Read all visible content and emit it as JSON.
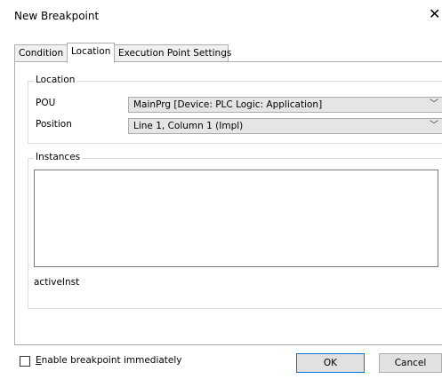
{
  "window": {
    "title": "New Breakpoint",
    "close_glyph": "✕"
  },
  "tabs": [
    {
      "label": "Condition"
    },
    {
      "label": "Location"
    },
    {
      "label": "Execution Point Settings"
    }
  ],
  "location_group": {
    "legend": "Location",
    "pou_label": "POU",
    "pou_value": "MainPrg [Device: PLC Logic: Application]",
    "position_label": "Position",
    "position_value": "Line 1, Column 1 (Impl)"
  },
  "instances_group": {
    "legend": "Instances",
    "active_inst_label": "activeInst"
  },
  "footer": {
    "enable_prefix": "E",
    "enable_rest": "nable breakpoint immediately",
    "enable_checked": false,
    "ok_label": "OK",
    "cancel_label": "Cancel"
  }
}
